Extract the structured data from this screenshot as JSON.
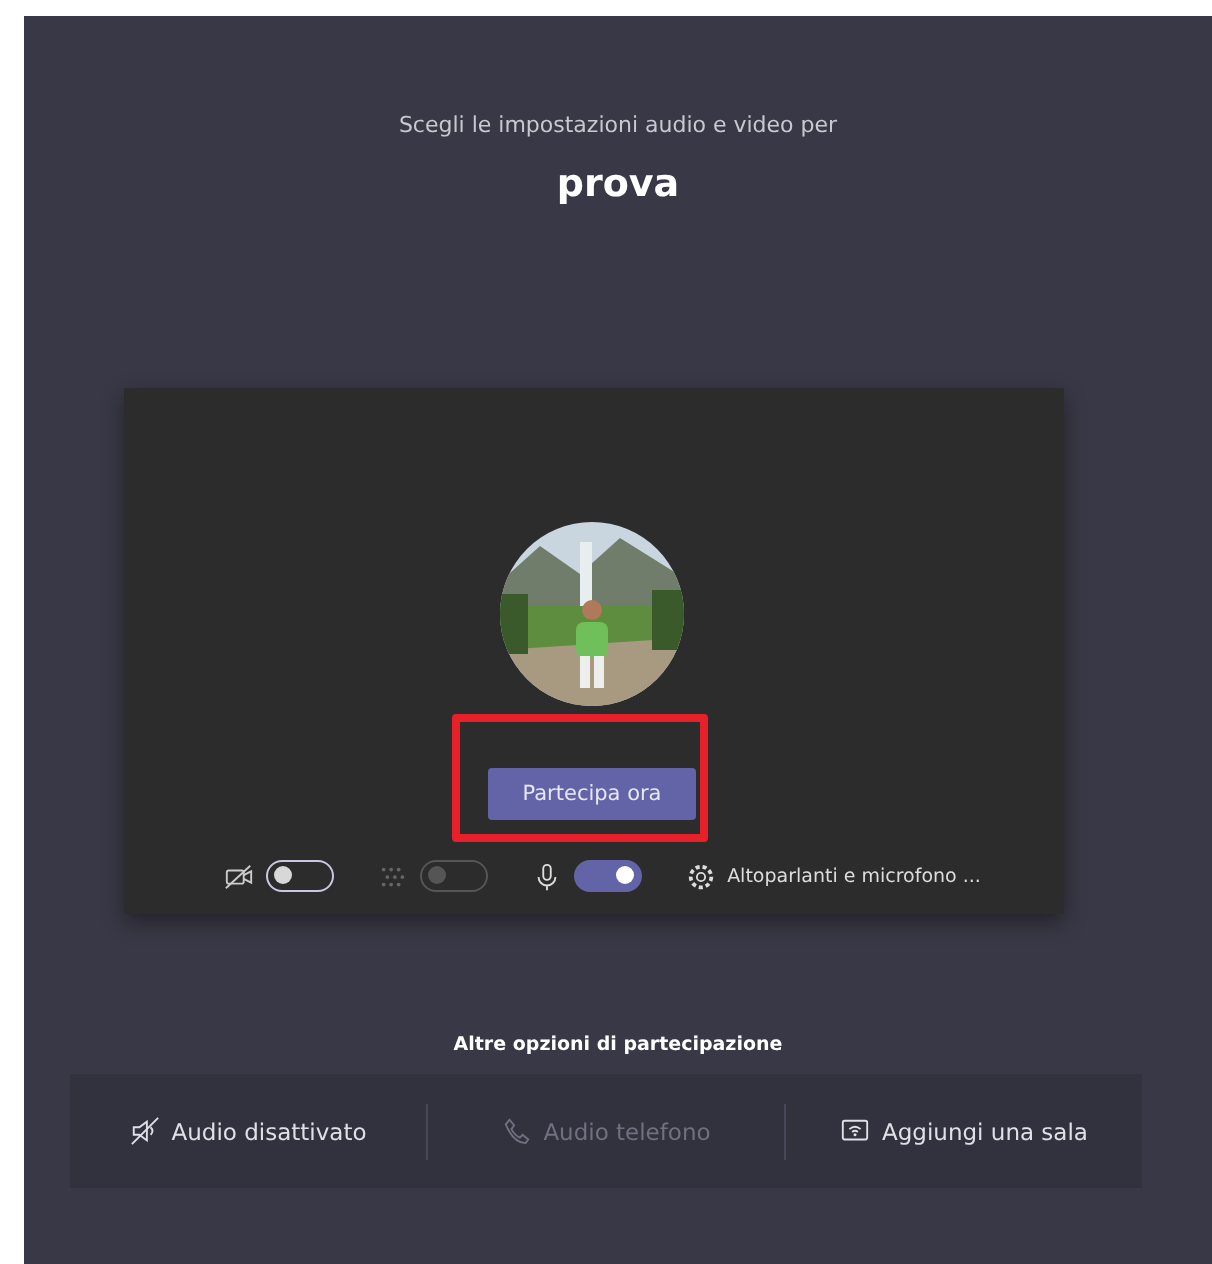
{
  "header": {
    "subtitle": "Scegli le impostazioni audio e video per",
    "meeting_name": "prova"
  },
  "preview": {
    "join_button": "Partecipa ora",
    "highlighted": true,
    "controls": [
      {
        "kind": "camera",
        "on": false,
        "disabled": false
      },
      {
        "kind": "blur",
        "on": false,
        "disabled": true
      },
      {
        "kind": "mic",
        "on": true,
        "disabled": false
      }
    ],
    "device_settings": "Altoparlanti e microfono ..."
  },
  "other_options": {
    "title": "Altre opzioni di partecipazione",
    "items": [
      {
        "kind": "audio-off",
        "label": "Audio disattivato",
        "disabled": false
      },
      {
        "kind": "phone",
        "label": "Audio telefono",
        "disabled": true
      },
      {
        "kind": "room",
        "label": "Aggiungi una sala",
        "disabled": false
      }
    ]
  }
}
